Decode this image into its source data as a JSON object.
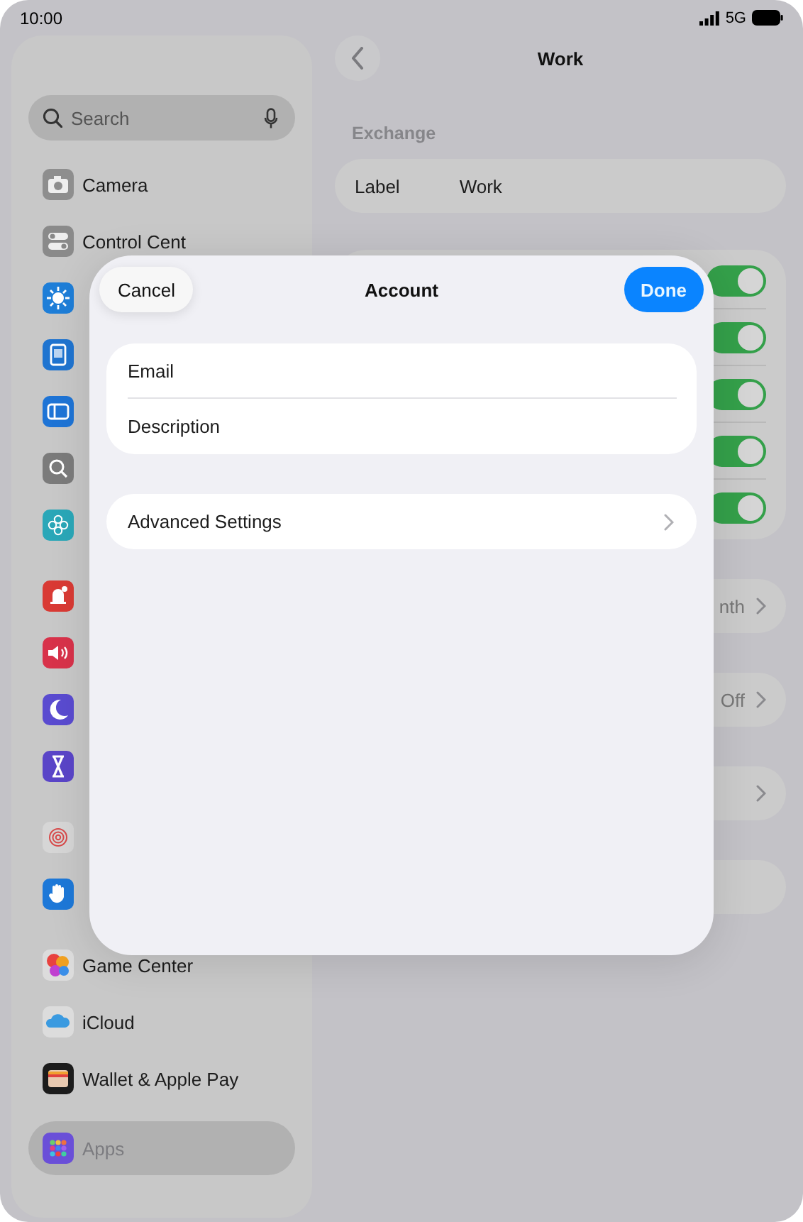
{
  "status_bar": {
    "time": "10:00",
    "network": "5G"
  },
  "sidebar": {
    "search": {
      "placeholder": "Search"
    },
    "groups": [
      {
        "items": [
          {
            "label": "Camera",
            "color": "#8e8e8e",
            "selected": false
          },
          {
            "label": "Control Cent",
            "color": "#8a8a8a",
            "selected": false
          },
          {
            "color": "#1e7ed8",
            "selected": false
          },
          {
            "color": "#1f74d0",
            "selected": false
          },
          {
            "color": "#1e74d6",
            "selected": false
          },
          {
            "color": "#7b7b7b",
            "selected": false
          },
          {
            "color": "#2aa7b8",
            "selected": false
          }
        ]
      },
      {
        "items": [
          {
            "color": "#d93a34",
            "selected": false
          },
          {
            "color": "#d8324a",
            "selected": false
          },
          {
            "color": "#5a4bd0",
            "selected": false
          },
          {
            "color": "#5a45c8",
            "selected": false
          }
        ]
      },
      {
        "items": [
          {
            "color": "#d6d6d6",
            "selected": false
          },
          {
            "color": "#1d78d8",
            "selected": false
          }
        ]
      },
      {
        "items": [
          {
            "label": "Game Center",
            "color": "#dcdcdc",
            "selected": false
          },
          {
            "label": "iCloud",
            "color": "#dcdcdc",
            "selected": false
          },
          {
            "label": "Wallet & Apple Pay",
            "color": "#1c1c1c",
            "selected": false
          }
        ]
      },
      {
        "items": [
          {
            "label": "Apps",
            "color": "#6a4fd8",
            "selected": true
          }
        ]
      }
    ]
  },
  "detail": {
    "title": "Work",
    "section": "Exchange",
    "label_row": {
      "label": "Label",
      "value": "Work"
    },
    "toggles": [
      {
        "on": true
      },
      {
        "on": true
      },
      {
        "on": true
      },
      {
        "on": true
      },
      {
        "on": true
      }
    ],
    "rows": [
      {
        "value": "nth",
        "chevron": true
      },
      {
        "value": "Off",
        "chevron": true
      },
      {
        "chevron": true
      },
      {
        "chevron": false
      }
    ]
  },
  "sheet": {
    "title": "Account",
    "cancel": "Cancel",
    "done": "Done",
    "fields": [
      {
        "placeholder": "Email"
      },
      {
        "placeholder": "Description"
      }
    ],
    "links": [
      {
        "label": "Advanced Settings"
      }
    ]
  }
}
